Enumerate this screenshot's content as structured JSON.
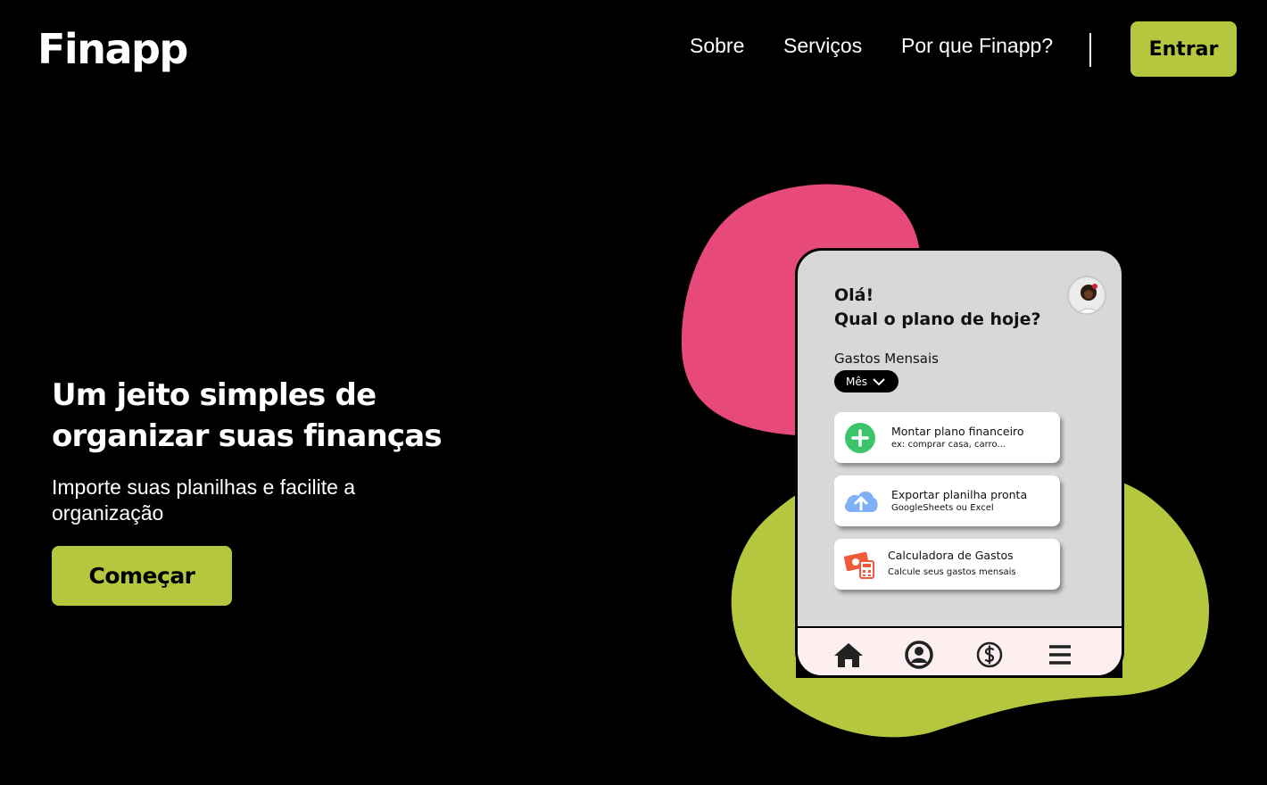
{
  "header": {
    "logo": "Finapp",
    "nav": [
      {
        "label": "Sobre"
      },
      {
        "label": "Serviços"
      },
      {
        "label": "Por que Finapp?"
      }
    ],
    "login_label": "Entrar"
  },
  "hero": {
    "title": "Um jeito simples de organizar suas finanças",
    "subtitle": "Importe suas planilhas e facilite a organização",
    "cta_label": "Começar"
  },
  "mockup": {
    "greeting_line1": "Olá!",
    "greeting_line2": "Qual o plano de hoje?",
    "section_label": "Gastos Mensais",
    "period_select": "Mês",
    "cards": [
      {
        "title": "Montar plano financeiro",
        "subtitle": "ex: comprar casa, carro...",
        "icon": "plus-icon"
      },
      {
        "title": "Exportar planilha pronta",
        "subtitle": "GoogleSheets ou Excel",
        "icon": "cloud-upload-icon"
      },
      {
        "title": "Calculadora de Gastos",
        "subtitle": "Calcule seus gastos mensais",
        "icon": "calculator-icon"
      }
    ],
    "bottom_nav": [
      "home-icon",
      "profile-icon",
      "dollar-icon",
      "menu-icon"
    ]
  },
  "colors": {
    "background": "#000000",
    "accent_green": "#b5c63f",
    "blob_pink": "#e6497a",
    "phone_bg": "#d8d8d8"
  }
}
